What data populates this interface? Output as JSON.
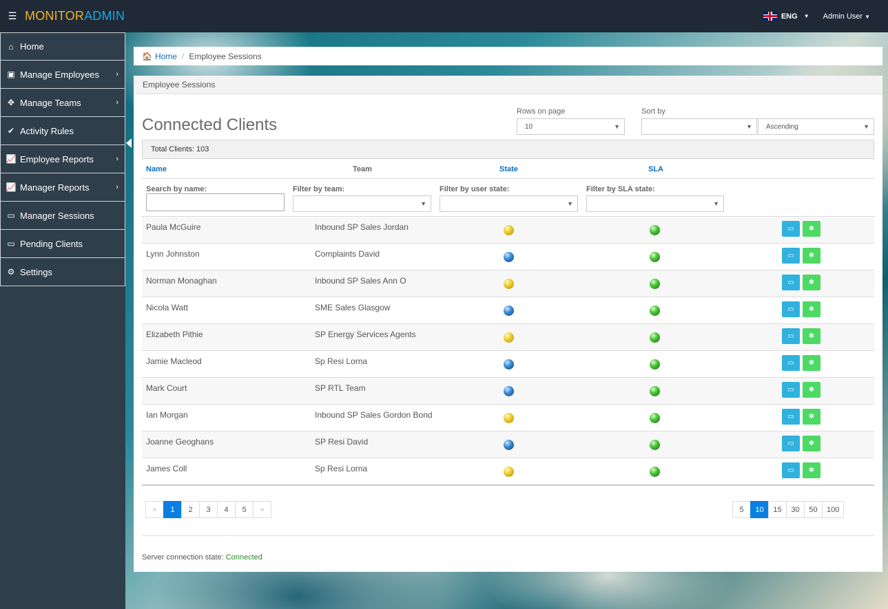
{
  "app": {
    "brand_a": "MONITOR",
    "brand_b": "ADMIN",
    "lang": "ENG",
    "user": "Admin User"
  },
  "colors": {
    "topbar": "#1f2a36",
    "sidebar": "#2f3e4b",
    "link": "#0a6dc2",
    "accent_yellow": "#f0b429",
    "accent_blue": "#1ea7e1",
    "pager_active": "#0a7fe0"
  },
  "sidebar": {
    "items": [
      {
        "label": "Home",
        "icon": "home-icon"
      },
      {
        "label": "Manage Employees",
        "icon": "address-book-icon"
      },
      {
        "label": "Manage Teams",
        "icon": "move-arrows-icon"
      },
      {
        "label": "Activity Rules",
        "icon": "check-icon"
      },
      {
        "label": "Employee Reports",
        "icon": "line-chart-icon"
      },
      {
        "label": "Manager Reports",
        "icon": "line-chart-icon"
      },
      {
        "label": "Manager Sessions",
        "icon": "monitor-icon"
      },
      {
        "label": "Pending Clients",
        "icon": "monitor-icon"
      },
      {
        "label": "Settings",
        "icon": "gears-icon"
      }
    ]
  },
  "breadcrumb": {
    "home": "Home",
    "current": "Employee Sessions"
  },
  "panel": {
    "heading": "Employee Sessions",
    "title": "Connected Clients"
  },
  "controls": {
    "rows_label": "Rows on page",
    "rows_value": "10",
    "sort_label": "Sort by",
    "sort_value": "",
    "order_value": "Ascending"
  },
  "total": "Total Clients: 103",
  "columns": {
    "name": "Name",
    "team": "Team",
    "state": "State",
    "sla": "SLA"
  },
  "filters": {
    "name": "Search by name:",
    "team": "Filter by team:",
    "state": "Filter by user state:",
    "sla": "Filter by SLA state:",
    "name_value": "",
    "team_value": "",
    "state_value": "",
    "sla_value": ""
  },
  "rows": [
    {
      "name": "Paula McGuire",
      "team": "Inbound SP Sales Jordan",
      "state": "yellow",
      "sla": "green"
    },
    {
      "name": "Lynn Johnston",
      "team": "Complaints David",
      "state": "blue",
      "sla": "green"
    },
    {
      "name": "Norman Monaghan",
      "team": "Inbound SP Sales Ann O",
      "state": "yellow",
      "sla": "green"
    },
    {
      "name": "Nicola Watt",
      "team": "SME Sales Glasgow",
      "state": "blue",
      "sla": "green"
    },
    {
      "name": "Elizabeth Pithie",
      "team": "SP Energy Services Agents",
      "state": "yellow",
      "sla": "green"
    },
    {
      "name": "Jamie Macleod",
      "team": "Sp Resi Lorna",
      "state": "blue",
      "sla": "green"
    },
    {
      "name": "Mark Court",
      "team": "SP RTL Team",
      "state": "blue",
      "sla": "green"
    },
    {
      "name": "Ian Morgan",
      "team": "Inbound SP Sales Gordon Bond",
      "state": "yellow",
      "sla": "green"
    },
    {
      "name": "Joanne Geoghans",
      "team": "SP Resi David",
      "state": "blue",
      "sla": "green"
    },
    {
      "name": "James Coll",
      "team": "Sp Resi Lorna",
      "state": "yellow",
      "sla": "green"
    }
  ],
  "pagination": {
    "prev": "«",
    "pages": [
      "1",
      "2",
      "3",
      "4",
      "5"
    ],
    "next": "»",
    "active": "1"
  },
  "page_sizes": {
    "options": [
      "5",
      "10",
      "15",
      "30",
      "50",
      "100"
    ],
    "active": "10"
  },
  "status": {
    "label": "Server connection state:",
    "value": "Connected"
  }
}
